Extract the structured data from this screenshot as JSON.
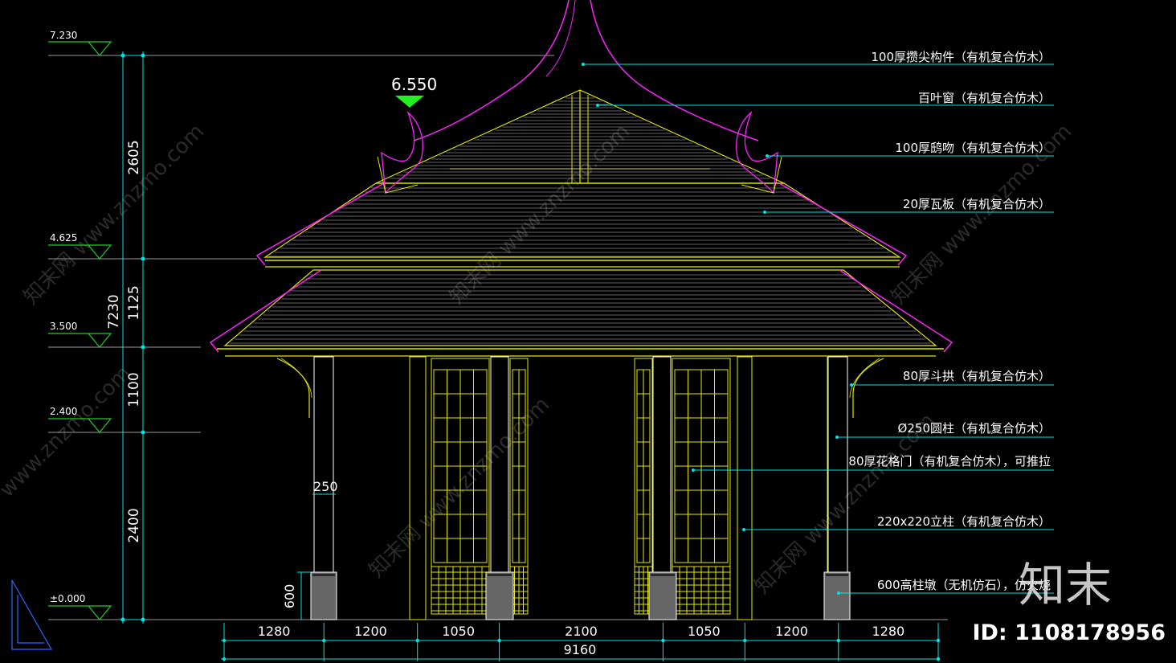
{
  "colors": {
    "background": "#000000",
    "cyan": "#00e5e5",
    "yellow": "#e6e600",
    "magenta": "#ff22ff",
    "green": "#22cc22",
    "white": "#ffffff",
    "grey": "#9a9a9a"
  },
  "levels": {
    "top": "7.230",
    "eave_upper": "4.625",
    "eave_lower": "3.500",
    "beam": "2.400",
    "ground": "±0.000",
    "ridge": "6.550"
  },
  "vertical_dims": {
    "d1": "2605",
    "d2": "1125",
    "d3": "1100",
    "d4": "2400",
    "total": "7230",
    "plinth": "600",
    "column_dia": "250"
  },
  "horizontal_dims": {
    "segments": [
      "1280",
      "1200",
      "1050",
      "2100",
      "1050",
      "1200",
      "1280"
    ],
    "total": "9160"
  },
  "annotations": [
    "100厚攒尖构件（有机复合仿木）",
    "百叶窗（有机复合仿木）",
    "100厚鸱吻（有机复合仿木）",
    "20厚瓦板（有机复合仿木）",
    "80厚斗拱（有机复合仿木）",
    "Ø250圆柱（有机复合仿木）",
    "80厚花格门（有机复合仿木），可推拉",
    "220x220立柱（有机复合仿木）",
    "600高柱墩（无机仿石），仿火烧"
  ],
  "watermark": {
    "logo": "知末",
    "site": "znzmo.com",
    "id": "ID: 1108178956"
  }
}
